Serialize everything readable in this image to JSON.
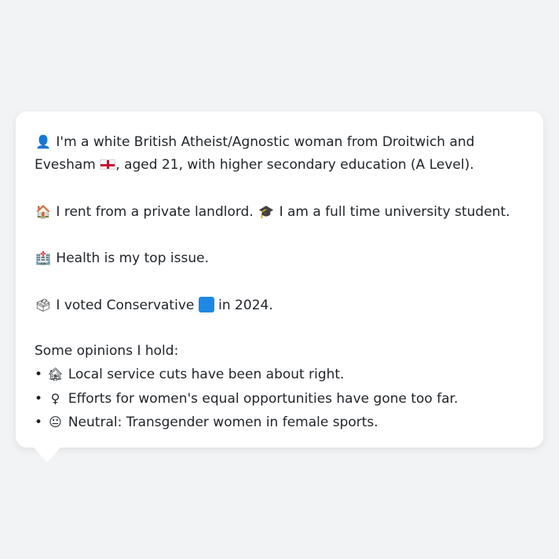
{
  "profile": {
    "intro_icon": "bust-in-silhouette-icon",
    "intro_line1": "I'm a white British Atheist/Agnostic woman from Droitwich and Evesham",
    "intro_flag_icon": "england-flag-icon",
    "intro_line2": ", aged 21, with higher secondary education (A Level).",
    "housing_icon": "house-icon",
    "housing_text": "I rent from a private landlord.",
    "student_icon": "graduation-cap-icon",
    "student_text": "I am a full time university student.",
    "health_icon": "hospital-icon",
    "health_text": "Health is my top issue.",
    "vote_icon": "ballot-box-icon",
    "vote_text_before": "I voted Conservative",
    "vote_party_icon": "blue-square-icon",
    "vote_text_after": "in 2024.",
    "opinions_heading": "Some opinions I hold:",
    "opinions": [
      {
        "bullet": "•",
        "icon": "derelict-house-icon",
        "text": "Local service cuts have been about right."
      },
      {
        "bullet": "•",
        "icon": "female-sign-icon",
        "text": "Efforts for women's equal opportunities have gone too far."
      },
      {
        "bullet": "•",
        "icon": "neutral-face-icon",
        "text": "Neutral: Transgender women in female sports."
      }
    ]
  },
  "colors": {
    "background": "#f2f3f5",
    "card": "#ffffff",
    "text": "#1f2328",
    "conservative_blue": "#1e88e5"
  }
}
